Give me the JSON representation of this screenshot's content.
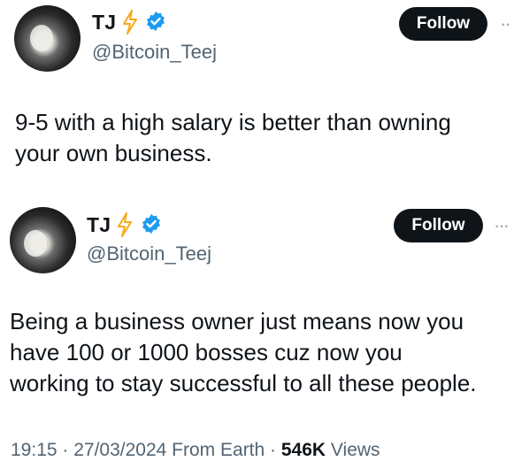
{
  "tweets": [
    {
      "name": "TJ",
      "handle": "@Bitcoin_Teej",
      "follow_label": "Follow",
      "more_label": "··",
      "text": "9-5 with a high salary is better than owning\nyour own business."
    },
    {
      "name": "TJ",
      "handle": "@Bitcoin_Teej",
      "follow_label": "Follow",
      "more_label": "···",
      "text": "Being a business owner just means now you\nhave 100 or 1000 bosses cuz now you\nworking to stay successful to all these people."
    }
  ],
  "meta": {
    "time": "19:15",
    "sep1": " · ",
    "date": "27/03/2024",
    "source": " From Earth",
    "sep2": " · ",
    "views_count": "546K",
    "views_label": " Views"
  },
  "colors": {
    "bolt": "#f7a91b",
    "verified": "#1d9bf0",
    "follow_bg": "#0f1419",
    "muted": "#536471"
  },
  "icons": [
    "lightning-bolt-icon",
    "verified-badge-icon",
    "more-options-icon"
  ]
}
